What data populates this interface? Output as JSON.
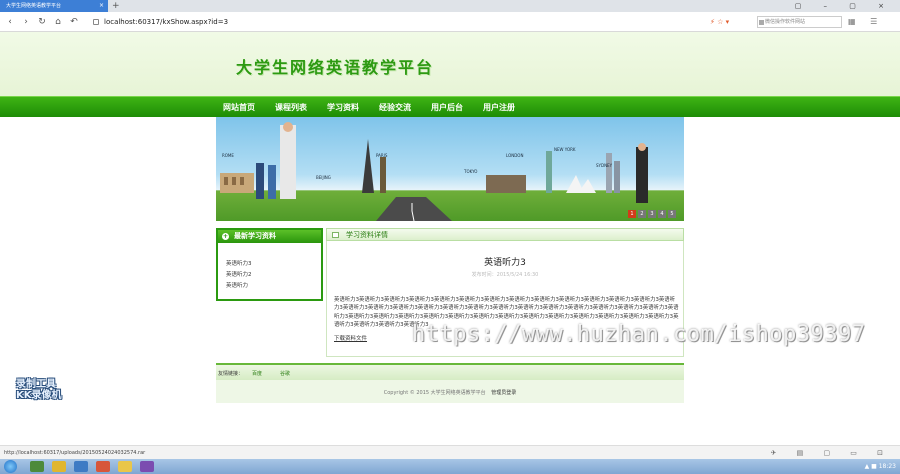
{
  "browser": {
    "tab_title": "大学生网络英语教学平台",
    "tab_close": "×",
    "new_tab": "+",
    "window_controls": "▢ – ▢ ×",
    "url": "localhost:60317/kxShow.aspx?id=3",
    "search_placeholder": "微信操作软件网站",
    "addr_icons": "⚡ ☆ ▾",
    "tool_icons": "▦ ☰"
  },
  "site": {
    "title": "大学生网络英语教学平台",
    "nav": [
      "网站首页",
      "课程列表",
      "学习资料",
      "经验交流",
      "用户后台",
      "用户注册"
    ]
  },
  "banner": {
    "cities": [
      "PARIS",
      "LONDON",
      "NEW YORK",
      "SYDNEY",
      "BEIJING",
      "ROME",
      "TOKYO"
    ],
    "pager": [
      "1",
      "2",
      "3",
      "4",
      "5"
    ],
    "active_page": 0
  },
  "sidebar": {
    "heading": "最新学习资料",
    "icon": "+",
    "items": [
      "英语听力3",
      "英语听力2",
      "英语听力"
    ]
  },
  "main": {
    "heading": "学习资料详情",
    "article_title": "英语听力3",
    "meta": "发布时间：2015/5/24 16:30",
    "body": "英语听力3英语听力3英语听力3英语听力3英语听力3英语听力3英语听力3英语听力3英语听力3英语听力3英语听力3英语听力3英语听力3英语听力3英语听力3英语听力3英语听力3英语听力3英语听力3英语听力3英语听力3英语听力3英语听力3英语听力3英语听力3英语听力3英语听力3英语听力3英语听力3英语听力3英语听力3英语听力3英语听力3英语听力3英语听力3英语听力3英语听力3英语听力3英语听力3英语听力3英语听力3英语听力3英语听力3英语听力3英语听力3",
    "download": "下载资料文件"
  },
  "watermark": "https://www.huzhan.com/ishop39397",
  "footer": {
    "links_label": "友情链接：",
    "links": [
      "百度",
      "谷歌"
    ],
    "copyright": "Copyright © 2015 大学生网络英语教学平台",
    "admin_link": "管理员登录"
  },
  "recorder": {
    "line1": "录制工具",
    "line2": "KK录像机"
  },
  "status": {
    "url": "http://localhost:60317/uploads/20150524024032574.rar",
    "icons": "✈ ▤ ▢ ▭ ⊡"
  },
  "taskbar": {
    "tray_text": "▲ ■ 18:23"
  },
  "colors": {
    "brand_green": "#2d9a12",
    "nav_green": "#1d8c06",
    "tab_blue": "#3d7fd6",
    "pager_active": "#d23a1a"
  }
}
